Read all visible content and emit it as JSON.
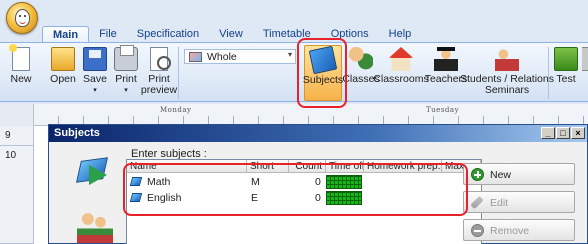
{
  "ribbon_tabs": [
    {
      "label": "Main",
      "active": true
    },
    {
      "label": "File"
    },
    {
      "label": "Specification"
    },
    {
      "label": "View"
    },
    {
      "label": "Timetable"
    },
    {
      "label": "Options"
    },
    {
      "label": "Help"
    }
  ],
  "ribbon_buttons": {
    "new": "New",
    "open": "Open",
    "save": "Save",
    "print": "Print",
    "print_preview_line1": "Print",
    "print_preview_line2": "preview",
    "subjects": "Subjects",
    "classes": "Classes",
    "classrooms": "Classrooms",
    "teachers": "Teachers",
    "students_line1": "Students / Relations",
    "students_line2": "Seminars",
    "test": "Test"
  },
  "view_select": {
    "value": "Whole"
  },
  "timetable": {
    "days": [
      "Monday",
      "Tuesday"
    ],
    "rows": [
      "9",
      "10"
    ]
  },
  "dialog": {
    "title": "Subjects",
    "window_buttons": {
      "minimize": "_",
      "maximize": "□",
      "close": "×"
    },
    "enter_label": "Enter subjects :",
    "columns": [
      "Name",
      "Short",
      "Count",
      "Time off",
      "Homework prep...",
      "Max"
    ],
    "subjects": [
      {
        "name": "Math",
        "short": "M",
        "count": "0"
      },
      {
        "name": "English",
        "short": "E",
        "count": "0"
      }
    ],
    "buttons": {
      "new": "New",
      "edit": "Edit",
      "remove": "Remove"
    }
  },
  "colors": {
    "accent": "#15428b",
    "highlight": "#f7b24a",
    "annotation": "#e8222a",
    "timeoff_green": "#18b418"
  }
}
